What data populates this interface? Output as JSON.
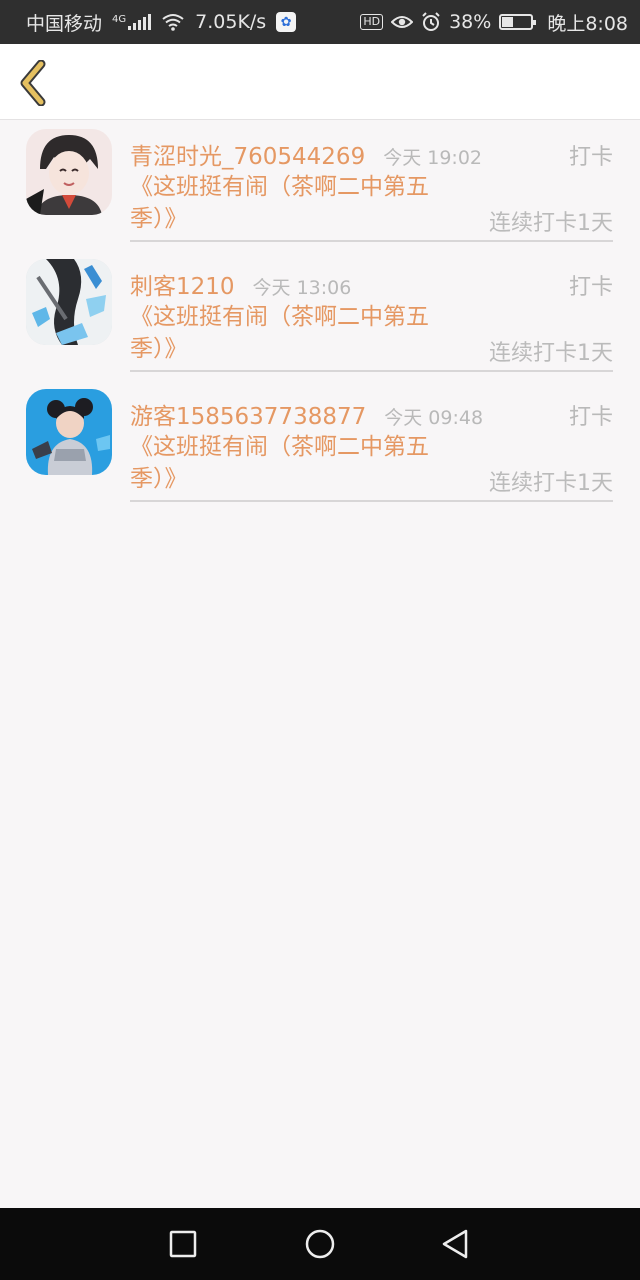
{
  "status_bar": {
    "carrier": "中国移动",
    "network": "4G",
    "speed": "7.05K/s",
    "battery": "38%",
    "battery_level": 0.38,
    "time": "晚上8:08",
    "icons": [
      "signal-icon",
      "wifi-icon",
      "baidu-icon",
      "hd-icon",
      "eye-icon",
      "alarm-icon",
      "battery-icon"
    ]
  },
  "header": {
    "back_icon": "chevron-left-icon",
    "accent_color": "#e5c060"
  },
  "entries": [
    {
      "name": "青涩时光_760544269",
      "time": "今天 19:02",
      "action": "打卡",
      "title": "《这班挺有闹（茶啊二中第五季）》",
      "streak": "连续打卡1天"
    },
    {
      "name": "刺客1210",
      "time": "今天 13:06",
      "action": "打卡",
      "title": "《这班挺有闹（茶啊二中第五季）》",
      "streak": "连续打卡1天"
    },
    {
      "name": "游客1585637738877",
      "time": "今天 09:48",
      "action": "打卡",
      "title": "《这班挺有闹（茶啊二中第五季）》",
      "streak": "连续打卡1天"
    }
  ],
  "colors": {
    "name_text": "#e59863",
    "muted_text": "#b9b9b9",
    "background": "#f8f6f7"
  },
  "nav_bar": {
    "icons": [
      "recent-apps-icon",
      "home-icon",
      "back-triangle-icon"
    ]
  }
}
